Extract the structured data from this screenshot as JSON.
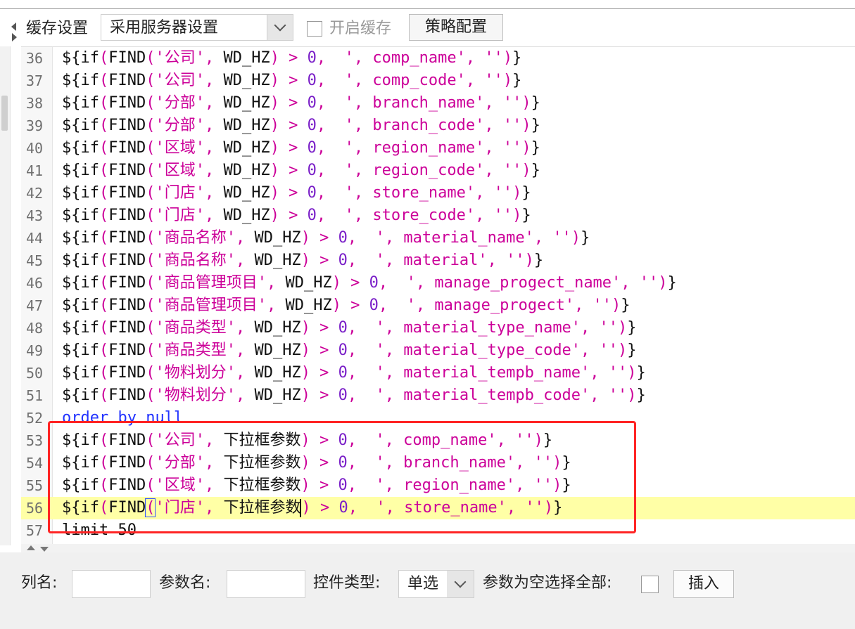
{
  "toolbar": {
    "cache_label": "缓存设置",
    "cache_select_value": "采用服务器设置",
    "enable_cache_label": "开启缓存",
    "enable_cache_checked": false,
    "strategy_button": "策略配置"
  },
  "editor": {
    "highlighted_line": 56,
    "lines": [
      {
        "n": "36",
        "tokens": [
          {
            "t": "${if",
            "c": "kw"
          },
          {
            "t": "(",
            "c": "p"
          },
          {
            "t": "FIND",
            "c": "kw"
          },
          {
            "t": "('公司', ",
            "c": "s"
          },
          {
            "t": "WD_HZ",
            "c": "kw"
          },
          {
            "t": ") > ",
            "c": "p"
          },
          {
            "t": "0",
            "c": "n"
          },
          {
            "t": ",  ', comp_name', '')",
            "c": "s"
          },
          {
            "t": "}",
            "c": "kw"
          }
        ]
      },
      {
        "n": "37",
        "tokens": [
          {
            "t": "${if",
            "c": "kw"
          },
          {
            "t": "(",
            "c": "p"
          },
          {
            "t": "FIND",
            "c": "kw"
          },
          {
            "t": "('公司', ",
            "c": "s"
          },
          {
            "t": "WD_HZ",
            "c": "kw"
          },
          {
            "t": ") > ",
            "c": "p"
          },
          {
            "t": "0",
            "c": "n"
          },
          {
            "t": ",  ', comp_code', '')",
            "c": "s"
          },
          {
            "t": "}",
            "c": "kw"
          }
        ]
      },
      {
        "n": "38",
        "tokens": [
          {
            "t": "${if",
            "c": "kw"
          },
          {
            "t": "(",
            "c": "p"
          },
          {
            "t": "FIND",
            "c": "kw"
          },
          {
            "t": "('分部', ",
            "c": "s"
          },
          {
            "t": "WD_HZ",
            "c": "kw"
          },
          {
            "t": ") > ",
            "c": "p"
          },
          {
            "t": "0",
            "c": "n"
          },
          {
            "t": ",  ', branch_name', '')",
            "c": "s"
          },
          {
            "t": "}",
            "c": "kw"
          }
        ]
      },
      {
        "n": "39",
        "tokens": [
          {
            "t": "${if",
            "c": "kw"
          },
          {
            "t": "(",
            "c": "p"
          },
          {
            "t": "FIND",
            "c": "kw"
          },
          {
            "t": "('分部', ",
            "c": "s"
          },
          {
            "t": "WD_HZ",
            "c": "kw"
          },
          {
            "t": ") > ",
            "c": "p"
          },
          {
            "t": "0",
            "c": "n"
          },
          {
            "t": ",  ', branch_code', '')",
            "c": "s"
          },
          {
            "t": "}",
            "c": "kw"
          }
        ]
      },
      {
        "n": "40",
        "tokens": [
          {
            "t": "${if",
            "c": "kw"
          },
          {
            "t": "(",
            "c": "p"
          },
          {
            "t": "FIND",
            "c": "kw"
          },
          {
            "t": "('区域', ",
            "c": "s"
          },
          {
            "t": "WD_HZ",
            "c": "kw"
          },
          {
            "t": ") > ",
            "c": "p"
          },
          {
            "t": "0",
            "c": "n"
          },
          {
            "t": ",  ', region_name', '')",
            "c": "s"
          },
          {
            "t": "}",
            "c": "kw"
          }
        ]
      },
      {
        "n": "41",
        "tokens": [
          {
            "t": "${if",
            "c": "kw"
          },
          {
            "t": "(",
            "c": "p"
          },
          {
            "t": "FIND",
            "c": "kw"
          },
          {
            "t": "('区域', ",
            "c": "s"
          },
          {
            "t": "WD_HZ",
            "c": "kw"
          },
          {
            "t": ") > ",
            "c": "p"
          },
          {
            "t": "0",
            "c": "n"
          },
          {
            "t": ",  ', region_code', '')",
            "c": "s"
          },
          {
            "t": "}",
            "c": "kw"
          }
        ]
      },
      {
        "n": "42",
        "tokens": [
          {
            "t": "${if",
            "c": "kw"
          },
          {
            "t": "(",
            "c": "p"
          },
          {
            "t": "FIND",
            "c": "kw"
          },
          {
            "t": "('门店', ",
            "c": "s"
          },
          {
            "t": "WD_HZ",
            "c": "kw"
          },
          {
            "t": ") > ",
            "c": "p"
          },
          {
            "t": "0",
            "c": "n"
          },
          {
            "t": ",  ', store_name', '')",
            "c": "s"
          },
          {
            "t": "}",
            "c": "kw"
          }
        ]
      },
      {
        "n": "43",
        "tokens": [
          {
            "t": "${if",
            "c": "kw"
          },
          {
            "t": "(",
            "c": "p"
          },
          {
            "t": "FIND",
            "c": "kw"
          },
          {
            "t": "('门店', ",
            "c": "s"
          },
          {
            "t": "WD_HZ",
            "c": "kw"
          },
          {
            "t": ") > ",
            "c": "p"
          },
          {
            "t": "0",
            "c": "n"
          },
          {
            "t": ",  ', store_code', '')",
            "c": "s"
          },
          {
            "t": "}",
            "c": "kw"
          }
        ]
      },
      {
        "n": "44",
        "tokens": [
          {
            "t": "${if",
            "c": "kw"
          },
          {
            "t": "(",
            "c": "p"
          },
          {
            "t": "FIND",
            "c": "kw"
          },
          {
            "t": "('商品名称', ",
            "c": "s"
          },
          {
            "t": "WD_HZ",
            "c": "kw"
          },
          {
            "t": ") > ",
            "c": "p"
          },
          {
            "t": "0",
            "c": "n"
          },
          {
            "t": ",  ', material_name', '')",
            "c": "s"
          },
          {
            "t": "}",
            "c": "kw"
          }
        ]
      },
      {
        "n": "45",
        "tokens": [
          {
            "t": "${if",
            "c": "kw"
          },
          {
            "t": "(",
            "c": "p"
          },
          {
            "t": "FIND",
            "c": "kw"
          },
          {
            "t": "('商品名称', ",
            "c": "s"
          },
          {
            "t": "WD_HZ",
            "c": "kw"
          },
          {
            "t": ") > ",
            "c": "p"
          },
          {
            "t": "0",
            "c": "n"
          },
          {
            "t": ",  ', material', '')",
            "c": "s"
          },
          {
            "t": "}",
            "c": "kw"
          }
        ]
      },
      {
        "n": "46",
        "tokens": [
          {
            "t": "${if",
            "c": "kw"
          },
          {
            "t": "(",
            "c": "p"
          },
          {
            "t": "FIND",
            "c": "kw"
          },
          {
            "t": "('商品管理项目', ",
            "c": "s"
          },
          {
            "t": "WD_HZ",
            "c": "kw"
          },
          {
            "t": ") > ",
            "c": "p"
          },
          {
            "t": "0",
            "c": "n"
          },
          {
            "t": ",  ', manage_progect_name', '')",
            "c": "s"
          },
          {
            "t": "}",
            "c": "kw"
          }
        ]
      },
      {
        "n": "47",
        "tokens": [
          {
            "t": "${if",
            "c": "kw"
          },
          {
            "t": "(",
            "c": "p"
          },
          {
            "t": "FIND",
            "c": "kw"
          },
          {
            "t": "('商品管理项目', ",
            "c": "s"
          },
          {
            "t": "WD_HZ",
            "c": "kw"
          },
          {
            "t": ") > ",
            "c": "p"
          },
          {
            "t": "0",
            "c": "n"
          },
          {
            "t": ",  ', manage_progect', '')",
            "c": "s"
          },
          {
            "t": "}",
            "c": "kw"
          }
        ]
      },
      {
        "n": "48",
        "tokens": [
          {
            "t": "${if",
            "c": "kw"
          },
          {
            "t": "(",
            "c": "p"
          },
          {
            "t": "FIND",
            "c": "kw"
          },
          {
            "t": "('商品类型', ",
            "c": "s"
          },
          {
            "t": "WD_HZ",
            "c": "kw"
          },
          {
            "t": ") > ",
            "c": "p"
          },
          {
            "t": "0",
            "c": "n"
          },
          {
            "t": ",  ', material_type_name', '')",
            "c": "s"
          },
          {
            "t": "}",
            "c": "kw"
          }
        ]
      },
      {
        "n": "49",
        "tokens": [
          {
            "t": "${if",
            "c": "kw"
          },
          {
            "t": "(",
            "c": "p"
          },
          {
            "t": "FIND",
            "c": "kw"
          },
          {
            "t": "('商品类型', ",
            "c": "s"
          },
          {
            "t": "WD_HZ",
            "c": "kw"
          },
          {
            "t": ") > ",
            "c": "p"
          },
          {
            "t": "0",
            "c": "n"
          },
          {
            "t": ",  ', material_type_code', '')",
            "c": "s"
          },
          {
            "t": "}",
            "c": "kw"
          }
        ]
      },
      {
        "n": "50",
        "tokens": [
          {
            "t": "${if",
            "c": "kw"
          },
          {
            "t": "(",
            "c": "p"
          },
          {
            "t": "FIND",
            "c": "kw"
          },
          {
            "t": "('物料划分', ",
            "c": "s"
          },
          {
            "t": "WD_HZ",
            "c": "kw"
          },
          {
            "t": ") > ",
            "c": "p"
          },
          {
            "t": "0",
            "c": "n"
          },
          {
            "t": ",  ', material_tempb_name', '')",
            "c": "s"
          },
          {
            "t": "}",
            "c": "kw"
          }
        ]
      },
      {
        "n": "51",
        "tokens": [
          {
            "t": "${if",
            "c": "kw"
          },
          {
            "t": "(",
            "c": "p"
          },
          {
            "t": "FIND",
            "c": "kw"
          },
          {
            "t": "('物料划分', ",
            "c": "s"
          },
          {
            "t": "WD_HZ",
            "c": "kw"
          },
          {
            "t": ") > ",
            "c": "p"
          },
          {
            "t": "0",
            "c": "n"
          },
          {
            "t": ",  ', material_tempb_code', '')",
            "c": "s"
          },
          {
            "t": "}",
            "c": "kw"
          }
        ]
      },
      {
        "n": "52",
        "tokens": [
          {
            "t": "order by null",
            "c": "b"
          }
        ]
      },
      {
        "n": "53",
        "tokens": [
          {
            "t": "${if",
            "c": "kw"
          },
          {
            "t": "(",
            "c": "p"
          },
          {
            "t": "FIND",
            "c": "kw"
          },
          {
            "t": "('公司', ",
            "c": "s"
          },
          {
            "t": "下拉框参数",
            "c": "kw"
          },
          {
            "t": ") > ",
            "c": "p"
          },
          {
            "t": "0",
            "c": "n"
          },
          {
            "t": ",  ', comp_name', '')",
            "c": "s"
          },
          {
            "t": "}",
            "c": "kw"
          }
        ]
      },
      {
        "n": "54",
        "tokens": [
          {
            "t": "${if",
            "c": "kw"
          },
          {
            "t": "(",
            "c": "p"
          },
          {
            "t": "FIND",
            "c": "kw"
          },
          {
            "t": "('分部', ",
            "c": "s"
          },
          {
            "t": "下拉框参数",
            "c": "kw"
          },
          {
            "t": ") > ",
            "c": "p"
          },
          {
            "t": "0",
            "c": "n"
          },
          {
            "t": ",  ', branch_name', '')",
            "c": "s"
          },
          {
            "t": "}",
            "c": "kw"
          }
        ]
      },
      {
        "n": "55",
        "tokens": [
          {
            "t": "${if",
            "c": "kw"
          },
          {
            "t": "(",
            "c": "p"
          },
          {
            "t": "FIND",
            "c": "kw"
          },
          {
            "t": "('区域', ",
            "c": "s"
          },
          {
            "t": "下拉框参数",
            "c": "kw"
          },
          {
            "t": ") > ",
            "c": "p"
          },
          {
            "t": "0",
            "c": "n"
          },
          {
            "t": ",  ', region_name', '')",
            "c": "s"
          },
          {
            "t": "}",
            "c": "kw"
          }
        ]
      },
      {
        "n": "56",
        "tokens": [
          {
            "t": "${if",
            "c": "kw"
          },
          {
            "t": "(",
            "c": "p"
          },
          {
            "t": "FIND",
            "c": "kw"
          },
          {
            "t": "(",
            "c": "p",
            "box": true
          },
          {
            "t": "'门店', ",
            "c": "s"
          },
          {
            "t": "下拉框参数",
            "c": "kw",
            "caret": true
          },
          {
            "t": ") > ",
            "c": "p"
          },
          {
            "t": "0",
            "c": "n"
          },
          {
            "t": ",  ', store_name', '')",
            "c": "s"
          },
          {
            "t": "}",
            "c": "kw"
          }
        ]
      },
      {
        "n": "57",
        "tokens": [
          {
            "t": "limit 50",
            "c": "kw"
          }
        ]
      }
    ]
  },
  "bottom": {
    "column_label": "列名:",
    "column_value": "",
    "param_label": "参数名:",
    "param_value": "",
    "control_type_label": "控件类型:",
    "control_type_value": "单选",
    "empty_select_all_label": "参数为空选择全部:",
    "empty_select_all_checked": false,
    "insert_button": "插入"
  },
  "colors": {
    "keyword": "#111111",
    "string": "#cc0099",
    "number": "#7a1fc8",
    "sql_keyword": "#2233ff",
    "highlight_line": "#ffffa6",
    "annotation_box": "#ff2424"
  }
}
